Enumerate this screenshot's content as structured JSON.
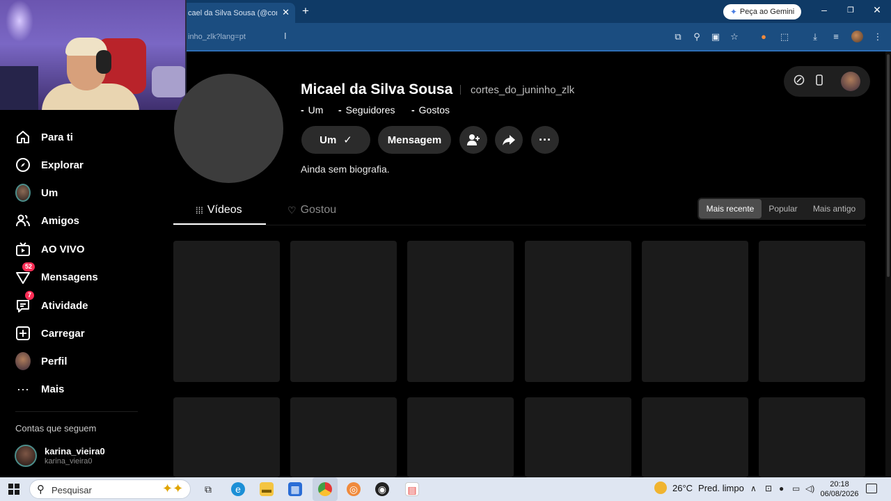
{
  "browser": {
    "tab_title": "cael da Silva Sousa (@cortes_",
    "tab_close": "✕",
    "new_tab": "+",
    "gemini_label": "Peça ao Gemini",
    "url": "inho_zlk?lang=pt"
  },
  "sidebar": {
    "items": [
      {
        "label": "Para ti",
        "icon": "home-icon"
      },
      {
        "label": "Explorar",
        "icon": "compass-icon"
      },
      {
        "label": "Um",
        "icon": "avatar-icon"
      },
      {
        "label": "Amigos",
        "icon": "friends-icon"
      },
      {
        "label": "AO VIVO",
        "icon": "live-icon"
      },
      {
        "label": "Mensagens",
        "icon": "messages-icon",
        "badge": "52"
      },
      {
        "label": "Atividade",
        "icon": "activity-icon",
        "badge": "7"
      },
      {
        "label": "Carregar",
        "icon": "upload-icon"
      },
      {
        "label": "Perfil",
        "icon": "profile-avatar-icon"
      },
      {
        "label": "Mais",
        "icon": "more-icon"
      }
    ],
    "following_title": "Contas que seguem",
    "following": [
      {
        "name": "karina_vieira0",
        "username": "karina_vieira0"
      }
    ]
  },
  "profile": {
    "name": "Micael da Silva Sousa",
    "username": "cortes_do_juninho_zlk",
    "stats": [
      {
        "value": "-",
        "label": "Um"
      },
      {
        "value": "-",
        "label": "Seguidores"
      },
      {
        "value": "-",
        "label": "Gostos"
      }
    ],
    "follow_button": "Um",
    "follow_check": "✓",
    "message_button": "Mensagem",
    "bio": "Ainda sem biografia."
  },
  "content_tabs": {
    "videos": "Vídeos",
    "liked": "Gostou"
  },
  "sort": {
    "options": [
      "Mais recente",
      "Popular",
      "Mais antigo"
    ],
    "selected": "Mais recente"
  },
  "taskbar": {
    "search_placeholder": "Pesquisar",
    "weather_temp": "26°C",
    "weather_desc": "Pred. limpo",
    "time": "20:18",
    "date": "06/08/2026"
  },
  "colors": {
    "background": "#000000",
    "accent_red": "#fe2c55",
    "browser_blue": "#1b4d80",
    "card": "#1b1b1b"
  }
}
